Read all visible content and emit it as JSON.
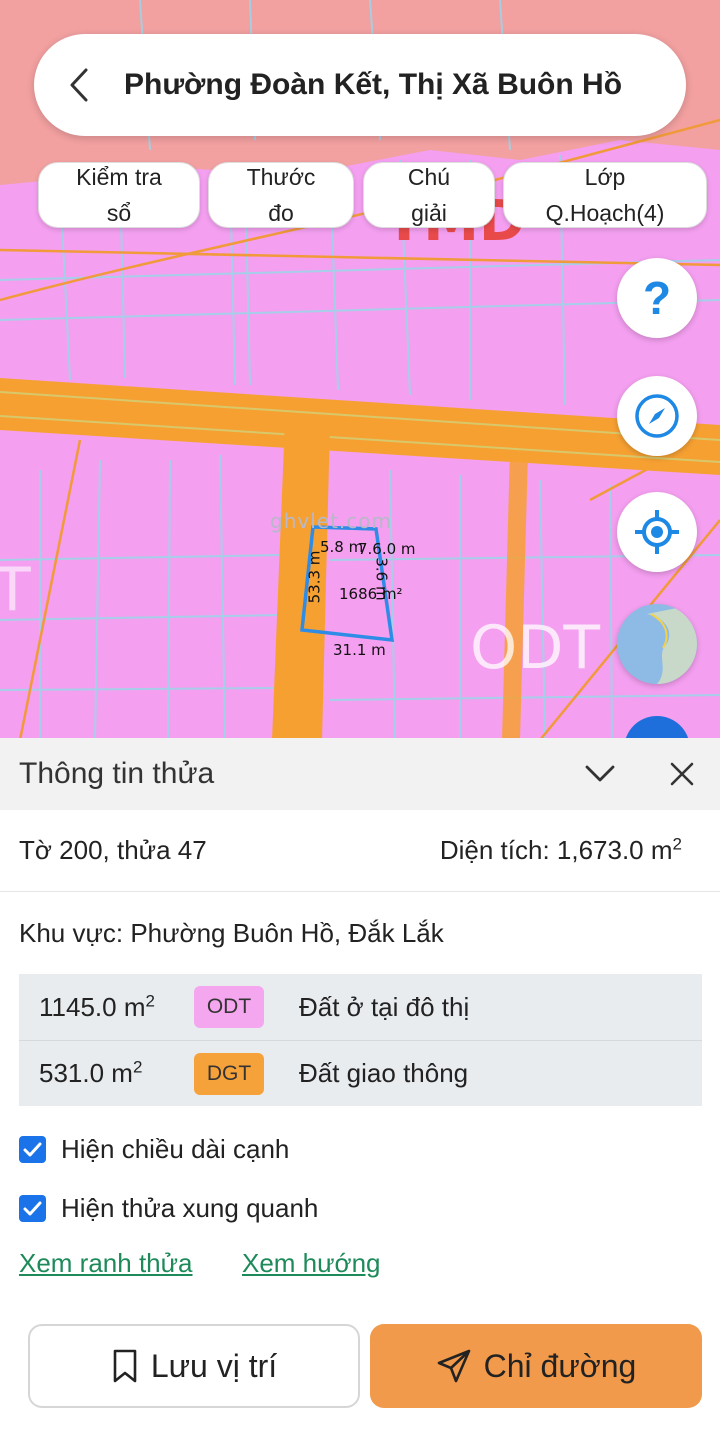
{
  "header": {
    "title": "Phường Đoàn Kết, Thị Xã Buôn Hồ"
  },
  "chips": {
    "kiem_tra": [
      "Kiểm tra",
      "sổ"
    ],
    "thuoc_do": [
      "Thước",
      "đo"
    ],
    "chu_giai": [
      "Chú",
      "giải"
    ],
    "lop": [
      "Lớp",
      "Q.Hoạch(4)"
    ]
  },
  "fabs": {
    "help": "?",
    "compass": "compass-icon",
    "locate": "locate-icon",
    "layers": "globe-icon"
  },
  "map": {
    "watermark": "ghvlet.com",
    "zone_top": "TMD",
    "zone_right": "ODT",
    "zone_left": "T",
    "edge_labels": {
      "top_left": "5.8 m",
      "top_right": "7.6.0 m",
      "left": "53.3 m",
      "right": "3.6 m",
      "bottom": "31.1 m"
    },
    "parcel_area": "1686 m²",
    "colors": {
      "residential": "#f49ff0",
      "road": "#f6a032",
      "commercial": "#f2a0a0",
      "parcel": "#2f8ce6"
    }
  },
  "sheet": {
    "title": "Thông tin thửa",
    "parcel_ref": "Tờ 200, thửa 47",
    "area_label": "Diện tích: 1,673.0 m",
    "area_sup": "2",
    "khu_vuc": "Khu vực: Phường Buôn Hồ, Đắk Lắk",
    "land_types": [
      {
        "amount": "1145.0 m",
        "sup": "2",
        "code": "ODT",
        "desc": "Đất ở tại đô thị",
        "color": "#f4a7ef"
      },
      {
        "amount": "531.0 m",
        "sup": "2",
        "code": "DGT",
        "desc": "Đất giao thông",
        "color": "#f6a23b"
      }
    ],
    "checkboxes": [
      {
        "label": "Hiện chiều dài cạnh",
        "checked": true
      },
      {
        "label": "Hiện thửa xung quanh",
        "checked": true
      }
    ],
    "links": {
      "ranh_thua": "Xem ranh thửa",
      "huong": "Xem hướng"
    },
    "buttons": {
      "save": "Lưu vị trí",
      "directions": "Chỉ đường"
    }
  }
}
